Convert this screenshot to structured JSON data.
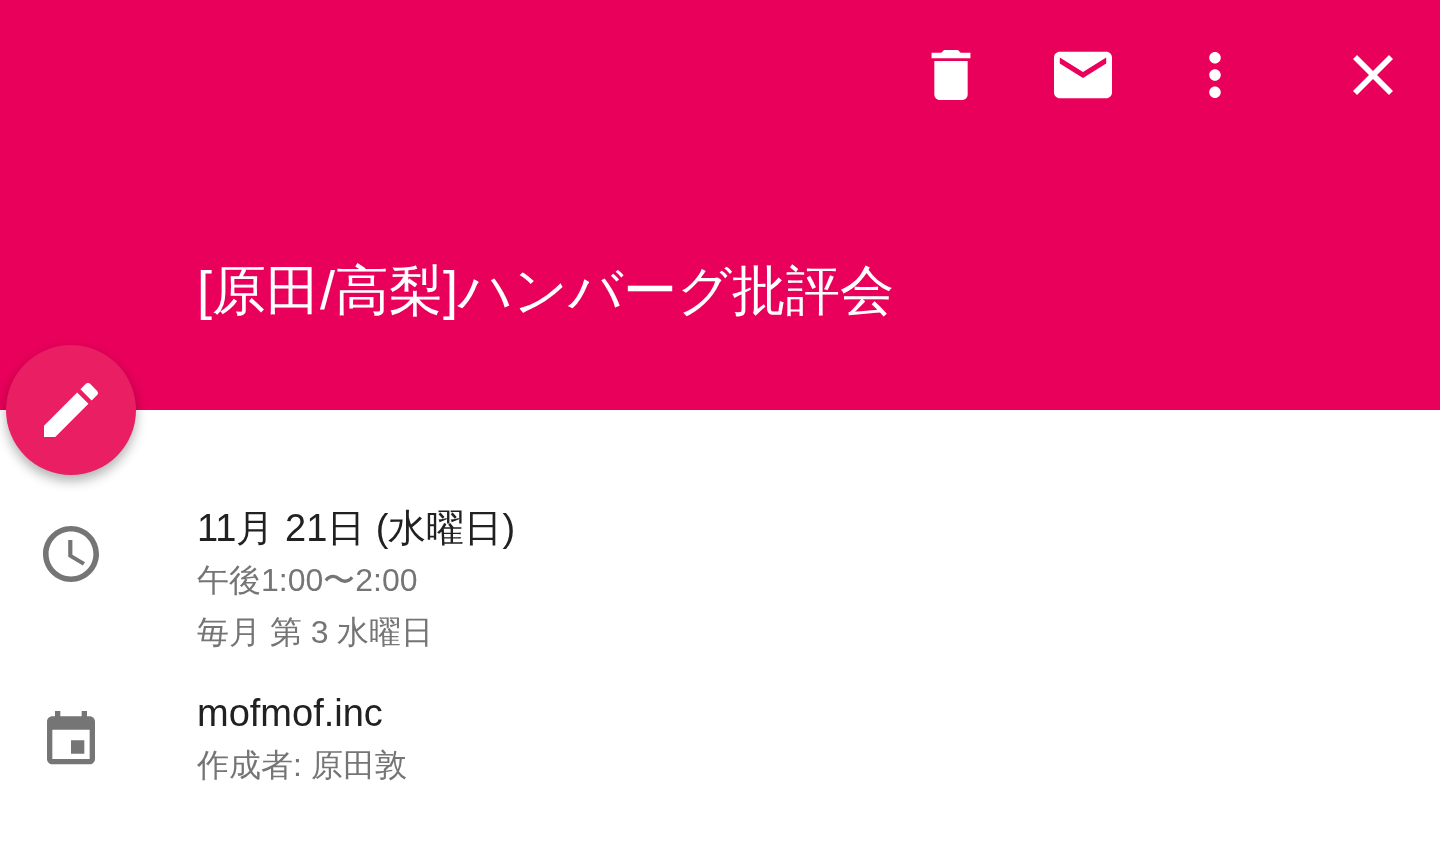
{
  "event": {
    "title": "[原田/高梨]ハンバーグ批評会"
  },
  "details": [
    {
      "kind": "time",
      "primary": "11月 21日 (水曜日)",
      "secondary": [
        "午後1:00〜2:00",
        "毎月 第 3 水曜日"
      ]
    },
    {
      "kind": "calendar",
      "primary": "mofmof.inc",
      "secondary": [
        "作成者: 原田敦"
      ]
    }
  ]
}
